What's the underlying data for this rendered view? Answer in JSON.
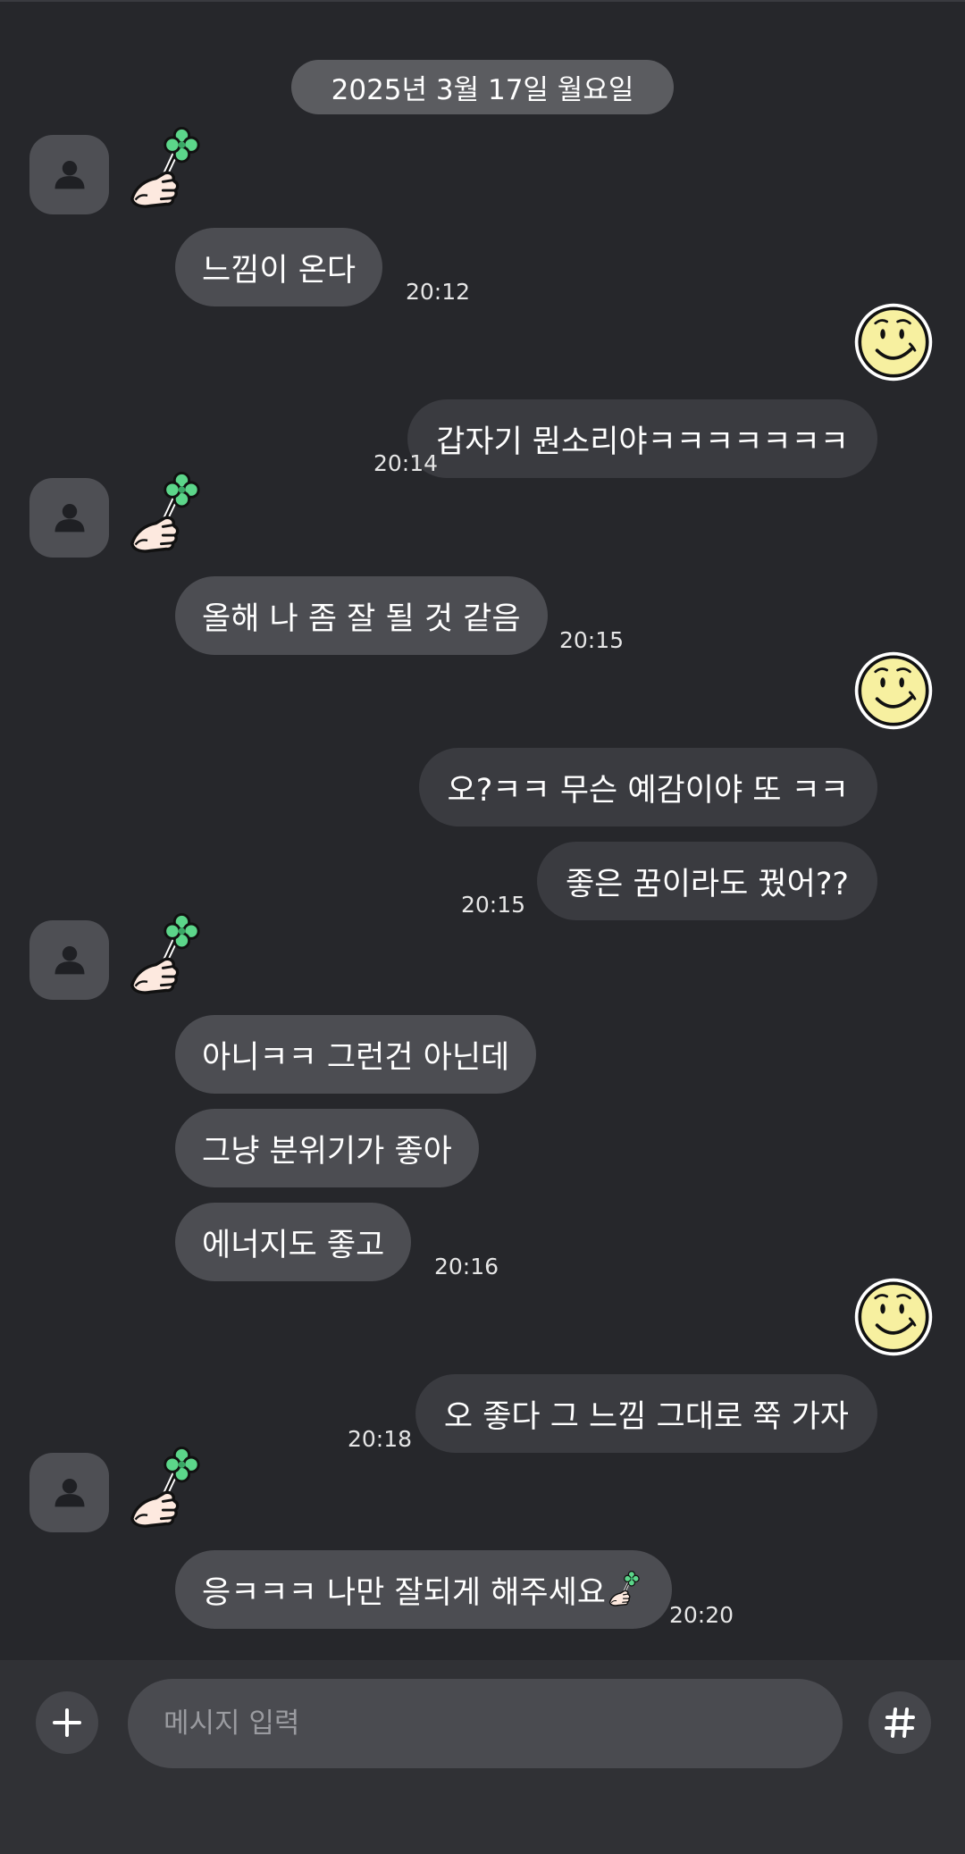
{
  "date_divider": "2025년 3월 17일 월요일",
  "messages": [
    {
      "text": "느낌이 온다",
      "time": "20:12"
    },
    {
      "text": "갑자기 뭔소리야ㅋㅋㅋㅋㅋㅋㅋ",
      "time": "20:14"
    },
    {
      "text": "올해 나 좀 잘 될 것 같음",
      "time": "20:15"
    },
    {
      "text": "오?ㅋㅋ 무슨 예감이야 또 ㅋㅋ",
      "time": ""
    },
    {
      "text": "좋은 꿈이라도 꿨어??",
      "time": "20:15"
    },
    {
      "text": "아니ㅋㅋ 그런건 아닌데",
      "time": ""
    },
    {
      "text": "그냥 분위기가 좋아",
      "time": ""
    },
    {
      "text": "에너지도 좋고",
      "time": "20:16"
    },
    {
      "text": "오 좋다 그 느낌 그대로 쭉 가자",
      "time": "20:18"
    },
    {
      "text": "응ㅋㅋㅋ 나만 잘되게 해주세요",
      "time": "20:20"
    }
  ],
  "composer": {
    "placeholder": "메시지 입력"
  },
  "icons": {
    "avatar": "person-icon",
    "sticker": "clover-hand-sticker",
    "my_avatar": "smiley-face-icon",
    "add": "plus-icon",
    "hashtag": "hash-icon"
  },
  "colors": {
    "background": "#26272b",
    "incoming_bubble": "#4c4d52",
    "outgoing_bubble": "#3a3b40",
    "smiley": "#f7f0a0",
    "clover": "#5cd68a"
  }
}
